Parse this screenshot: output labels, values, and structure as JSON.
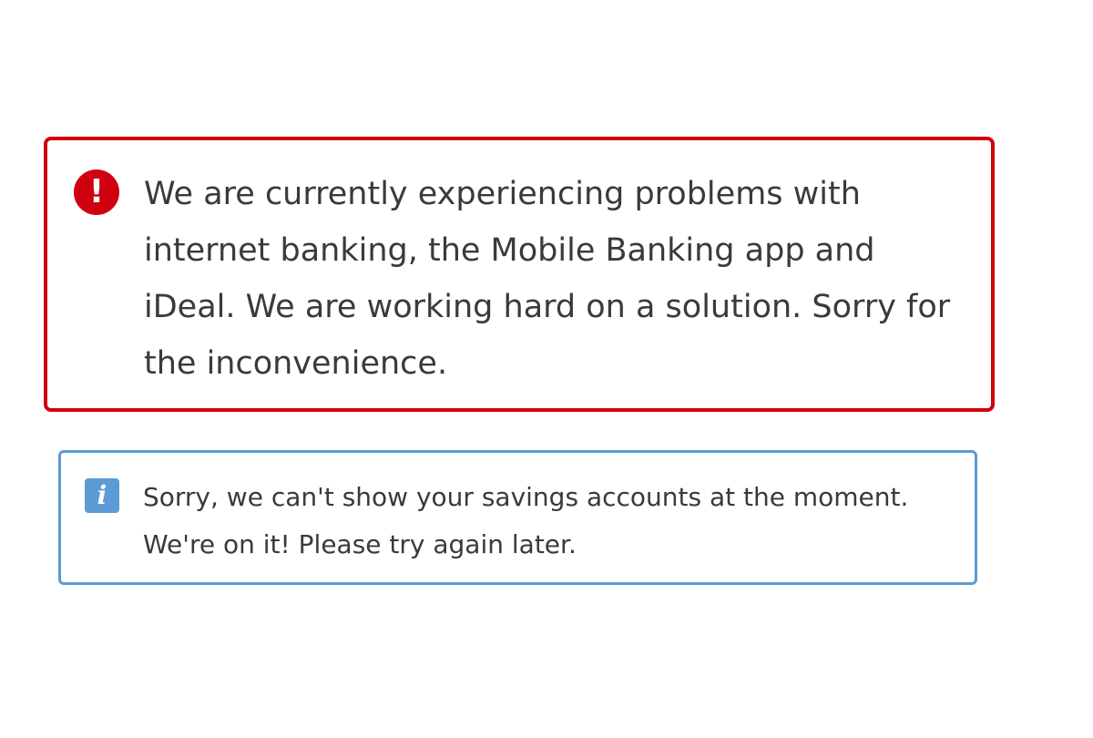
{
  "colors": {
    "error_border": "#d0000f",
    "info_border": "#5c9bd6",
    "text": "#3a3a3a",
    "background": "#ffffff"
  },
  "error_alert": {
    "icon": "exclamation-icon",
    "icon_glyph": "!",
    "message": "We are currently experiencing problems with internet banking, the Mobile Banking app and iDeal. We are working hard on a solution. Sorry for the inconvenience."
  },
  "info_alert": {
    "icon": "info-icon",
    "icon_glyph": "i",
    "message": "Sorry, we can't show your savings accounts at the moment. We're on it! Please try again later."
  }
}
